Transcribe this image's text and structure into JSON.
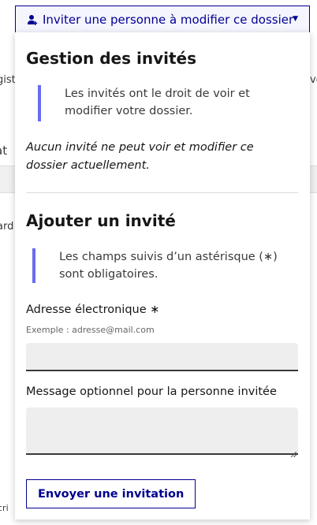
{
  "trigger": {
    "label": "Inviter une personne à modifier ce dossier",
    "icon": "add-user-icon",
    "caret_icon": "caret-down-icon"
  },
  "panel": {
    "guests_title": "Gestion des invités",
    "guests_notice": "Les invités ont le droit de voir et modifier votre dossier.",
    "no_guests_text": "Aucun invité ne peut voir et modifier ce dossier actuellement.",
    "add_title": "Ajouter un invité",
    "required_notice": "Les champs suivis d’un astérisque (∗) sont obligatoires.",
    "email": {
      "label": "Adresse électronique",
      "required_mark": "∗",
      "hint": "Exemple : adresse@mail.com",
      "value": ""
    },
    "message": {
      "label": "Message optionnel pour la personne invitée",
      "value": ""
    },
    "submit_label": "Envoyer une invitation"
  },
  "background": {
    "frag_left_1": "gist",
    "frag_right_1": "ve",
    "frag_left_2": "at",
    "frag_left_3": "ard",
    "frag_left_4": "cri"
  },
  "colors": {
    "primary": "#000091",
    "notice_bar": "#6a6af4",
    "input_bg": "#eeeeee"
  }
}
